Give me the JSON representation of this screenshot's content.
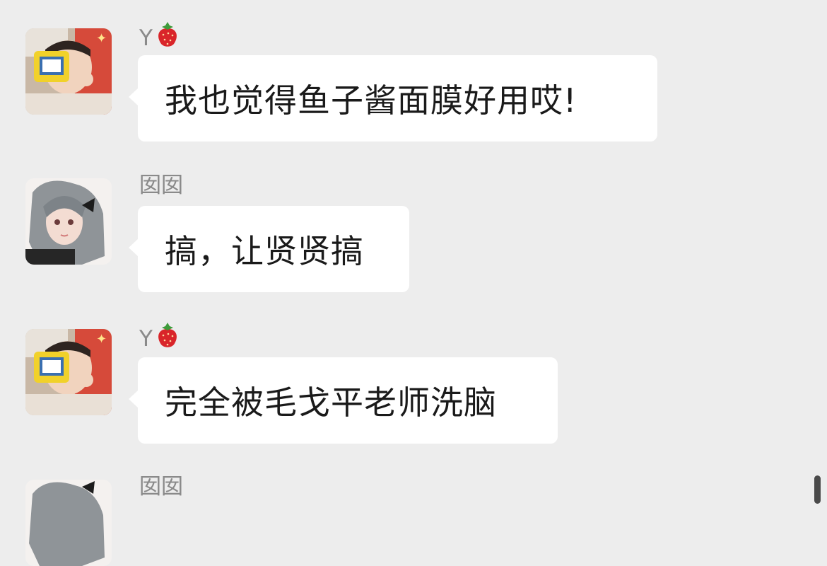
{
  "messages": [
    {
      "sender": "Y",
      "sender_emoji": "strawberry-icon",
      "text": "我也觉得鱼子酱面膜好用哎!",
      "avatar": "child-photo-avatar"
    },
    {
      "sender": "囡囡",
      "text": "搞，让贤贤搞",
      "avatar": "anime-girl-avatar"
    },
    {
      "sender": "Y",
      "sender_emoji": "strawberry-icon",
      "text": "完全被毛戈平老师洗脑",
      "avatar": "child-photo-avatar"
    },
    {
      "sender": "囡囡",
      "text": "",
      "avatar": "anime-girl-avatar"
    }
  ],
  "colors": {
    "background": "#ededed",
    "bubble": "#ffffff",
    "sender_name": "#8a8a8a",
    "message_text": "#1a1a1a"
  }
}
